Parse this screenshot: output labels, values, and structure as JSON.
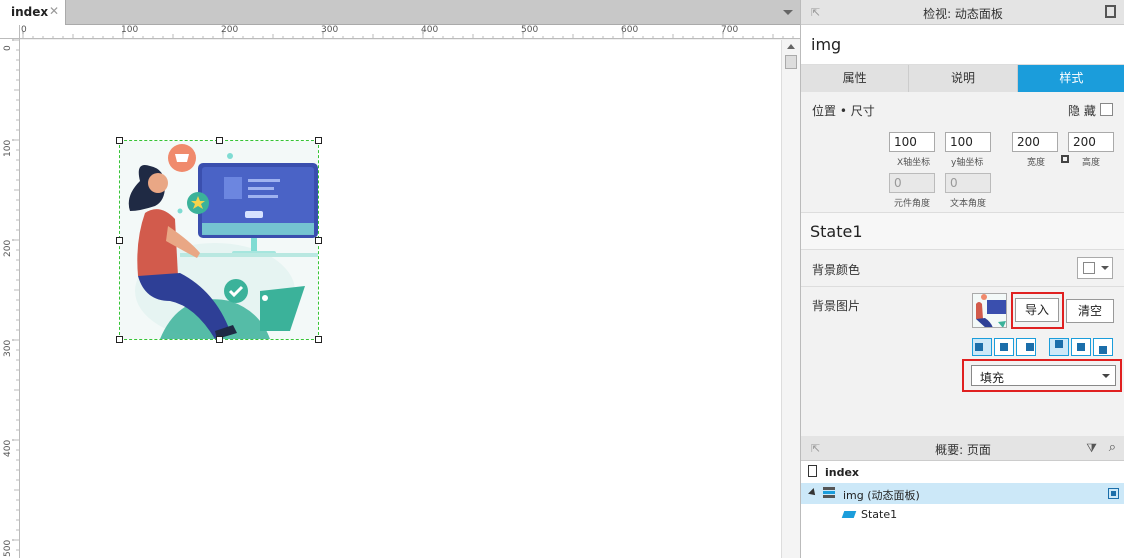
{
  "editor": {
    "tab_label": "index",
    "tab_close": "✕",
    "ruler_h_labels": [
      "0",
      "100",
      "200",
      "300",
      "400",
      "500",
      "600",
      "700"
    ],
    "ruler_v_labels": [
      "0",
      "100",
      "200",
      "300",
      "400",
      "500"
    ]
  },
  "inspector": {
    "title": "检视: 动态面板",
    "widget_name": "img",
    "tabs": [
      "属性",
      "说明",
      "样式"
    ],
    "active_tab": "样式",
    "position_label": "位置 • 尺寸",
    "hidden_label": "隐 藏",
    "x_value": "100",
    "y_value": "100",
    "width_value": "200",
    "height_value": "200",
    "x_caption": "X轴坐标",
    "y_caption": "y轴坐标",
    "width_caption": "宽度",
    "height_caption": "高度",
    "rotation_value": "0",
    "text_rotation_value": "0",
    "rotation_caption": "元件角度",
    "text_rotation_caption": "文本角度",
    "state_name": "State1",
    "bg_color_label": "背景颜色",
    "bg_image_label": "背景图片",
    "import_label": "导入",
    "clear_label": "清空",
    "fill_mode": "填充",
    "accent_color": "#1b9ddb",
    "highlight_color": "#e02020"
  },
  "outline": {
    "title": "概要: 页面",
    "page": "index",
    "items": [
      {
        "label": "img (动态面板)"
      },
      {
        "label": "State1"
      }
    ]
  }
}
